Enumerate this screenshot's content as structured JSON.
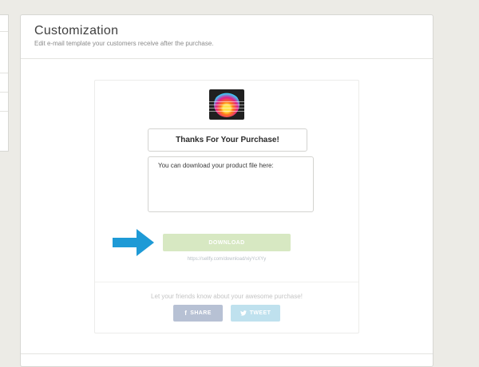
{
  "page": {
    "title": "Customization",
    "subtitle": "Edit e-mail template your customers receive after the purchase."
  },
  "email_preview": {
    "logo_icon": "product-logo-image",
    "title_text": "Thanks For Your Purchase!",
    "message_text": "You can download your product file here:",
    "download_label": "DOWNLOAD",
    "download_link": "https://sellfy.com/download/xiyYcXYy",
    "share_prompt": "Let your friends know about your awesome purchase!",
    "share_label": "SHARE",
    "share_icon": "facebook-icon",
    "tweet_label": "TWEET",
    "tweet_icon": "twitter-icon"
  },
  "colors": {
    "download_bg": "#d7e8c2",
    "share_bg": "#b7c1d4",
    "tweet_bg": "#bfe1ee",
    "arrow": "#1e9ad6"
  }
}
